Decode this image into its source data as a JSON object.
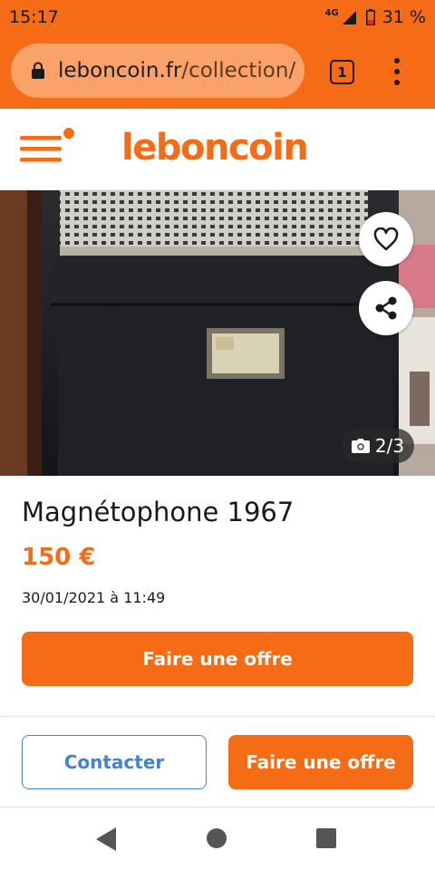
{
  "status_bar": {
    "time": "15:17",
    "network_label": "4G",
    "battery_percent": "31 %",
    "icons": [
      "signal-icon",
      "battery-icon"
    ]
  },
  "browser": {
    "url_domain": "leboncoin.fr",
    "url_path": "/collection/",
    "tab_count": "1",
    "icons": [
      "lock-icon",
      "menu-dots-icon"
    ]
  },
  "site_header": {
    "logo_text": "leboncoin",
    "icons": [
      "hamburger-menu-icon"
    ]
  },
  "photo": {
    "counter": "2/3",
    "icons": [
      "heart-icon",
      "share-icon",
      "camera-icon"
    ]
  },
  "listing": {
    "title": "Magnétophone 1967",
    "price": "150 €",
    "date": "30/01/2021 à 11:49",
    "offer_button": "Faire une offre"
  },
  "action_bar": {
    "contact_button": "Contacter",
    "offer_button": "Faire une offre"
  },
  "nav_bar": {
    "icons": [
      "back-icon",
      "home-icon",
      "recents-icon"
    ]
  },
  "colors": {
    "brand_orange": "#f56b16",
    "url_pill": "#fba26b",
    "contact_blue": "#4183d7"
  }
}
